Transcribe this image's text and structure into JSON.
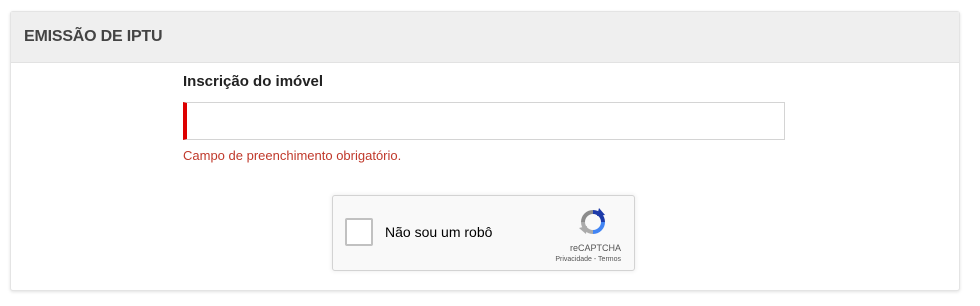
{
  "header": {
    "title": "EMISSÃO DE IPTU"
  },
  "form": {
    "field_label": "Inscrição do imóvel",
    "field_value": "",
    "error_message": "Campo de preenchimento obrigatório.",
    "error_color": "#dd0000"
  },
  "recaptcha": {
    "checkbox_label": "Não sou um robô",
    "checked": false,
    "logo_icon": "recaptcha-logo-icon",
    "brand": "reCAPTCHA",
    "privacy_link": "Privacidade",
    "separator": " - ",
    "terms_link": "Termos"
  }
}
